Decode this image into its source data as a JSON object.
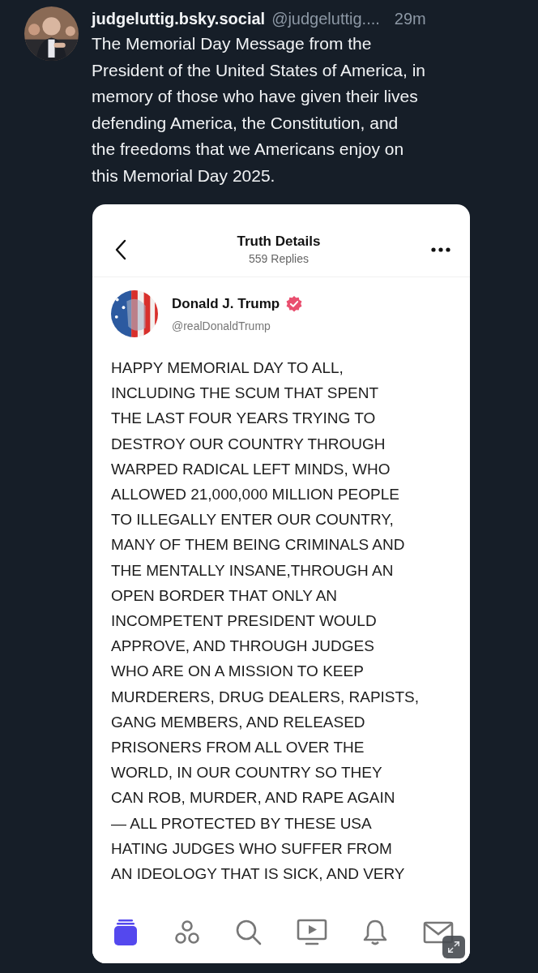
{
  "post": {
    "display_name": "judgeluttig.bsky.social",
    "handle": "@judgeluttig....",
    "time": "29m",
    "text_lines": [
      "The Memorial Day Message from the",
      "President of the United States of America, in",
      "memory of those who have given their lives",
      "defending America, the Constitution, and",
      "the freedoms that we Americans enjoy on",
      "this Memorial Day 2025."
    ]
  },
  "embed": {
    "header": {
      "title": "Truth Details",
      "subtitle": "559 Replies"
    },
    "author": {
      "name": "Donald J. Trump",
      "verified": true,
      "handle": "@realDonaldTrump"
    },
    "body_lines": [
      "HAPPY MEMORIAL DAY TO ALL,",
      "INCLUDING THE SCUM THAT SPENT",
      "THE LAST FOUR YEARS TRYING TO",
      "DESTROY OUR COUNTRY THROUGH",
      "WARPED RADICAL LEFT MINDS, WHO",
      "ALLOWED 21,000,000 MILLION PEOPLE",
      "TO ILLEGALLY ENTER OUR COUNTRY,",
      "MANY OF THEM BEING CRIMINALS AND",
      "THE MENTALLY INSANE,THROUGH AN",
      "OPEN BORDER THAT ONLY AN",
      "INCOMPETENT PRESIDENT WOULD",
      "APPROVE, AND THROUGH JUDGES",
      "WHO ARE ON A MISSION TO KEEP",
      "MURDERERS, DRUG DEALERS, RAPISTS,",
      "GANG MEMBERS, AND RELEASED",
      "PRISONERS FROM ALL OVER THE",
      "WORLD, IN OUR COUNTRY SO THEY",
      "CAN ROB, MURDER, AND RAPE AGAIN",
      "— ALL PROTECTED BY THESE USA",
      "HATING JUDGES WHO SUFFER FROM",
      "AN IDEOLOGY THAT IS SICK, AND VERY"
    ],
    "nav": [
      {
        "kind": "home",
        "selected": true
      },
      {
        "kind": "groups",
        "selected": false
      },
      {
        "kind": "search",
        "selected": false
      },
      {
        "kind": "video",
        "selected": false
      },
      {
        "kind": "bell",
        "selected": false
      },
      {
        "kind": "mail",
        "selected": false
      }
    ]
  }
}
